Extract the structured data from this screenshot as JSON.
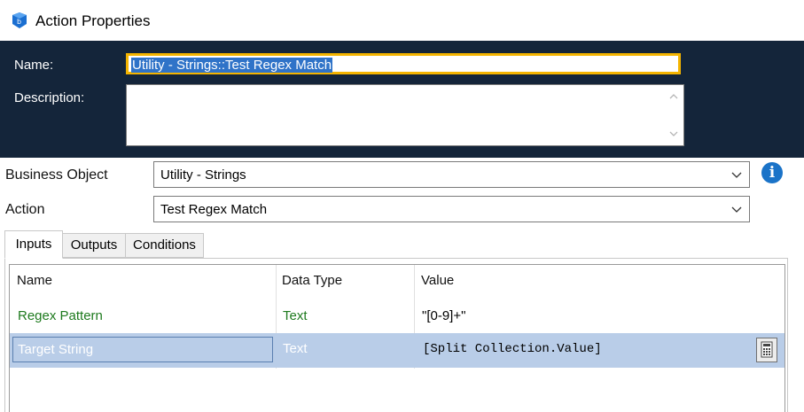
{
  "window": {
    "title": "Action Properties",
    "icon": "blue-prism-icon"
  },
  "header": {
    "name_label": "Name:",
    "name_value": "Utility - Strings::Test Regex Match",
    "description_label": "Description:",
    "description_value": ""
  },
  "fields": {
    "business_object_label": "Business Object",
    "business_object_value": "Utility - Strings",
    "action_label": "Action",
    "action_value": "Test Regex Match"
  },
  "tabs": [
    {
      "label": "Inputs",
      "active": true
    },
    {
      "label": "Outputs",
      "active": false
    },
    {
      "label": "Conditions",
      "active": false
    }
  ],
  "grid": {
    "columns": [
      "Name",
      "Data Type",
      "Value"
    ],
    "rows": [
      {
        "name": "Regex Pattern",
        "data_type": "Text",
        "value": "\"[0-9]+\""
      },
      {
        "name": "Target String",
        "data_type": "Text",
        "value": "[Split Collection.Value]"
      }
    ]
  },
  "colors": {
    "header_bg": "#14253a",
    "focus_border": "#f4b400",
    "selection": "#2f73c8",
    "row_highlight": "#b9cde8",
    "field_name_green": "#1e7a1e",
    "info_blue": "#1a73c8"
  }
}
